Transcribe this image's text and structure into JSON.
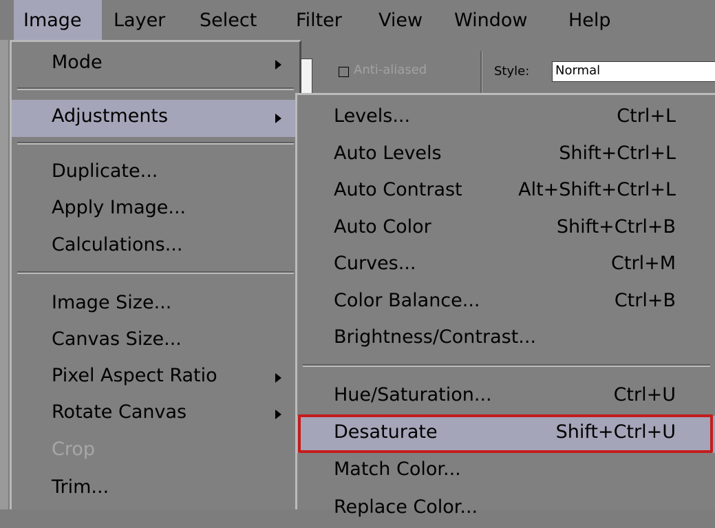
{
  "menubar": {
    "items": [
      {
        "label": "Image",
        "active": true
      },
      {
        "label": "Layer"
      },
      {
        "label": "Select"
      },
      {
        "label": "Filter"
      },
      {
        "label": "View"
      },
      {
        "label": "Window"
      },
      {
        "label": "Help"
      }
    ]
  },
  "options_bar": {
    "anti_aliased_label": "Anti-aliased",
    "style_label": "Style:",
    "style_value": "Normal"
  },
  "image_menu": {
    "items": [
      {
        "label": "Mode",
        "submenu": true
      },
      {
        "label": "Adjustments",
        "submenu": true,
        "highlighted": true
      },
      {
        "label": "Duplicate..."
      },
      {
        "label": "Apply Image..."
      },
      {
        "label": "Calculations..."
      },
      {
        "label": "Image Size..."
      },
      {
        "label": "Canvas Size..."
      },
      {
        "label": "Pixel Aspect Ratio",
        "submenu": true
      },
      {
        "label": "Rotate Canvas",
        "submenu": true
      },
      {
        "label": "Crop",
        "disabled": true
      },
      {
        "label": "Trim..."
      }
    ]
  },
  "adjustments_menu": {
    "items": [
      {
        "label": "Levels...",
        "shortcut": "Ctrl+L"
      },
      {
        "label": "Auto Levels",
        "shortcut": "Shift+Ctrl+L"
      },
      {
        "label": "Auto Contrast",
        "shortcut": "Alt+Shift+Ctrl+L"
      },
      {
        "label": "Auto Color",
        "shortcut": "Shift+Ctrl+B"
      },
      {
        "label": "Curves...",
        "shortcut": "Ctrl+M"
      },
      {
        "label": "Color Balance...",
        "shortcut": "Ctrl+B"
      },
      {
        "label": "Brightness/Contrast...",
        "shortcut": ""
      },
      {
        "label": "Hue/Saturation...",
        "shortcut": "Ctrl+U"
      },
      {
        "label": "Desaturate",
        "shortcut": "Shift+Ctrl+U",
        "highlighted": true
      },
      {
        "label": "Match Color...",
        "shortcut": ""
      },
      {
        "label": "Replace Color...",
        "shortcut": ""
      }
    ]
  },
  "colors": {
    "menu_bg": "#808080",
    "highlight": "#a4a5b8",
    "disabled_text": "#a7a7a7",
    "annotation": "#c41c1c"
  }
}
